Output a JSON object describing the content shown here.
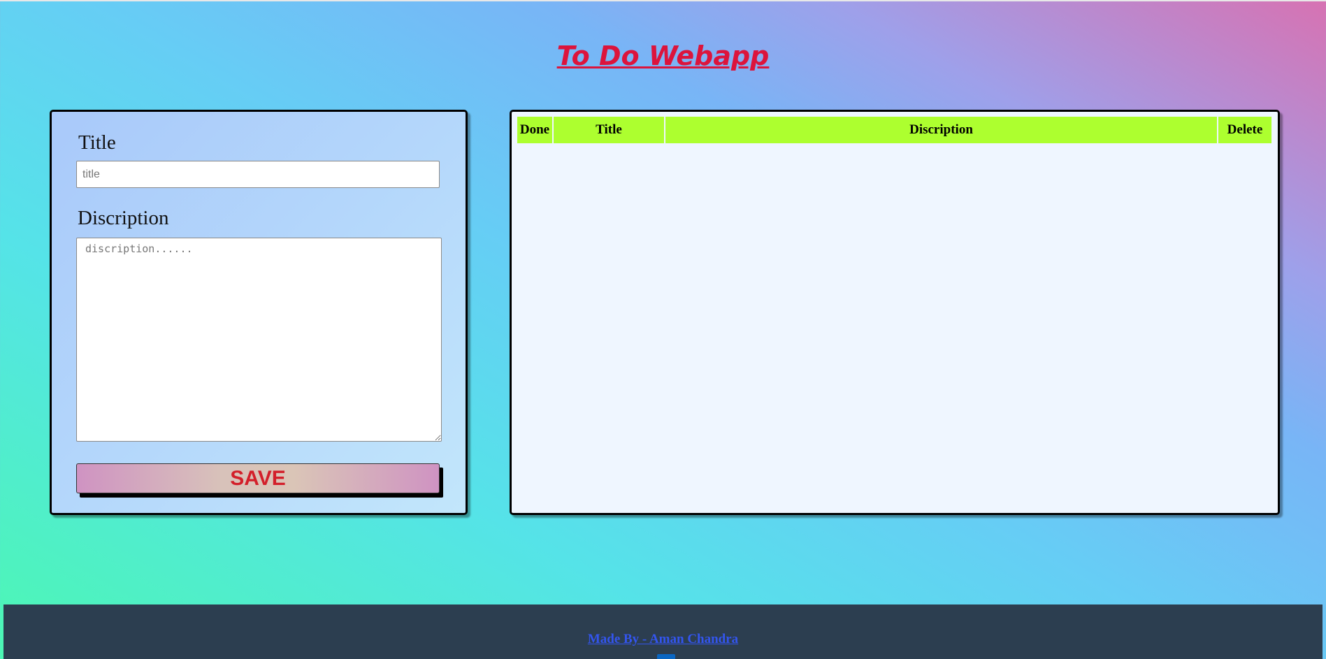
{
  "header": {
    "title": "To Do Webapp"
  },
  "form": {
    "title_label": "Title",
    "title_placeholder": "title",
    "title_value": "",
    "description_label": "Discription",
    "description_placeholder": "discription......",
    "description_value": "",
    "save_label": "SAVE"
  },
  "table": {
    "columns": [
      "Done",
      "Title",
      "Discription",
      "Delete"
    ],
    "rows": []
  },
  "footer": {
    "credit": "Made By - Aman Chandra",
    "icon": "linkedin-icon"
  },
  "colors": {
    "title": "#dc143c",
    "table_header": "#adff2f",
    "save_text": "#d31f2a",
    "footer_bg": "#2c3e50",
    "footer_link": "#3355ee"
  }
}
